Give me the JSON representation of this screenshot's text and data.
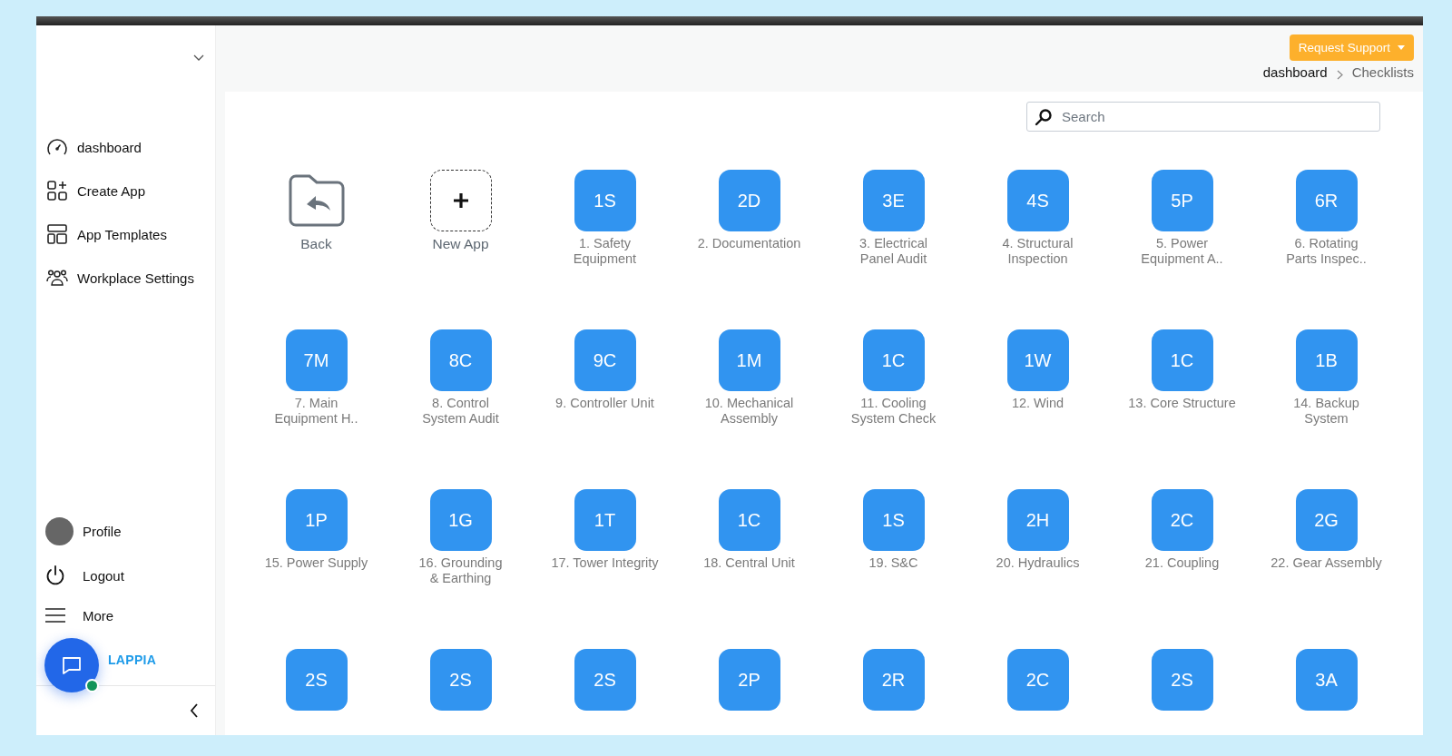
{
  "sidebar": {
    "nav_items": [
      {
        "label": "dashboard"
      },
      {
        "label": "Create App"
      },
      {
        "label": "App Templates"
      },
      {
        "label": "Workplace Settings"
      }
    ],
    "bottom_items": [
      {
        "label": "Profile"
      },
      {
        "label": "Logout"
      },
      {
        "label": "More"
      }
    ],
    "logo": "LAPPIA"
  },
  "header": {
    "support_button": "Request Support",
    "breadcrumb": [
      "dashboard",
      "Checklists"
    ]
  },
  "search": {
    "placeholder": "Search"
  },
  "apps": [
    {
      "kind": "back",
      "label": "Back"
    },
    {
      "kind": "new",
      "label": "New App"
    },
    {
      "kind": "app",
      "badge": "1S",
      "label": "1. Safety\nEquipment"
    },
    {
      "kind": "app",
      "badge": "2D",
      "label": "2. Documentation"
    },
    {
      "kind": "app",
      "badge": "3E",
      "label": "3. Electrical\nPanel Audit"
    },
    {
      "kind": "app",
      "badge": "4S",
      "label": "4. Structural\nInspection"
    },
    {
      "kind": "app",
      "badge": "5P",
      "label": "5. Power\nEquipment A.."
    },
    {
      "kind": "app",
      "badge": "6R",
      "label": "6. Rotating\nParts Inspec.."
    },
    {
      "kind": "app",
      "badge": "7M",
      "label": "7. Main\nEquipment H.."
    },
    {
      "kind": "app",
      "badge": "8C",
      "label": "8. Control\nSystem Audit"
    },
    {
      "kind": "app",
      "badge": "9C",
      "label": "9. Controller Unit"
    },
    {
      "kind": "app",
      "badge": "1M",
      "label": "10. Mechanical\nAssembly"
    },
    {
      "kind": "app",
      "badge": "1C",
      "label": "11. Cooling\nSystem Check"
    },
    {
      "kind": "app",
      "badge": "1W",
      "label": "12. Wind"
    },
    {
      "kind": "app",
      "badge": "1C",
      "label": "13. Core Structure"
    },
    {
      "kind": "app",
      "badge": "1B",
      "label": "14. Backup\nSystem"
    },
    {
      "kind": "app",
      "badge": "1P",
      "label": "15. Power Supply"
    },
    {
      "kind": "app",
      "badge": "1G",
      "label": "16. Grounding\n& Earthing"
    },
    {
      "kind": "app",
      "badge": "1T",
      "label": "17. Tower Integrity"
    },
    {
      "kind": "app",
      "badge": "1C",
      "label": "18. Central Unit"
    },
    {
      "kind": "app",
      "badge": "1S",
      "label": "19. S&C"
    },
    {
      "kind": "app",
      "badge": "2H",
      "label": "20. Hydraulics"
    },
    {
      "kind": "app",
      "badge": "2C",
      "label": "21. Coupling"
    },
    {
      "kind": "app",
      "badge": "2G",
      "label": "22. Gear Assembly"
    },
    {
      "kind": "app",
      "badge": "2S"
    },
    {
      "kind": "app",
      "badge": "2S"
    },
    {
      "kind": "app",
      "badge": "2S"
    },
    {
      "kind": "app",
      "badge": "2P"
    },
    {
      "kind": "app",
      "badge": "2R"
    },
    {
      "kind": "app",
      "badge": "2C"
    },
    {
      "kind": "app",
      "badge": "2S"
    },
    {
      "kind": "app",
      "badge": "3A"
    }
  ]
}
